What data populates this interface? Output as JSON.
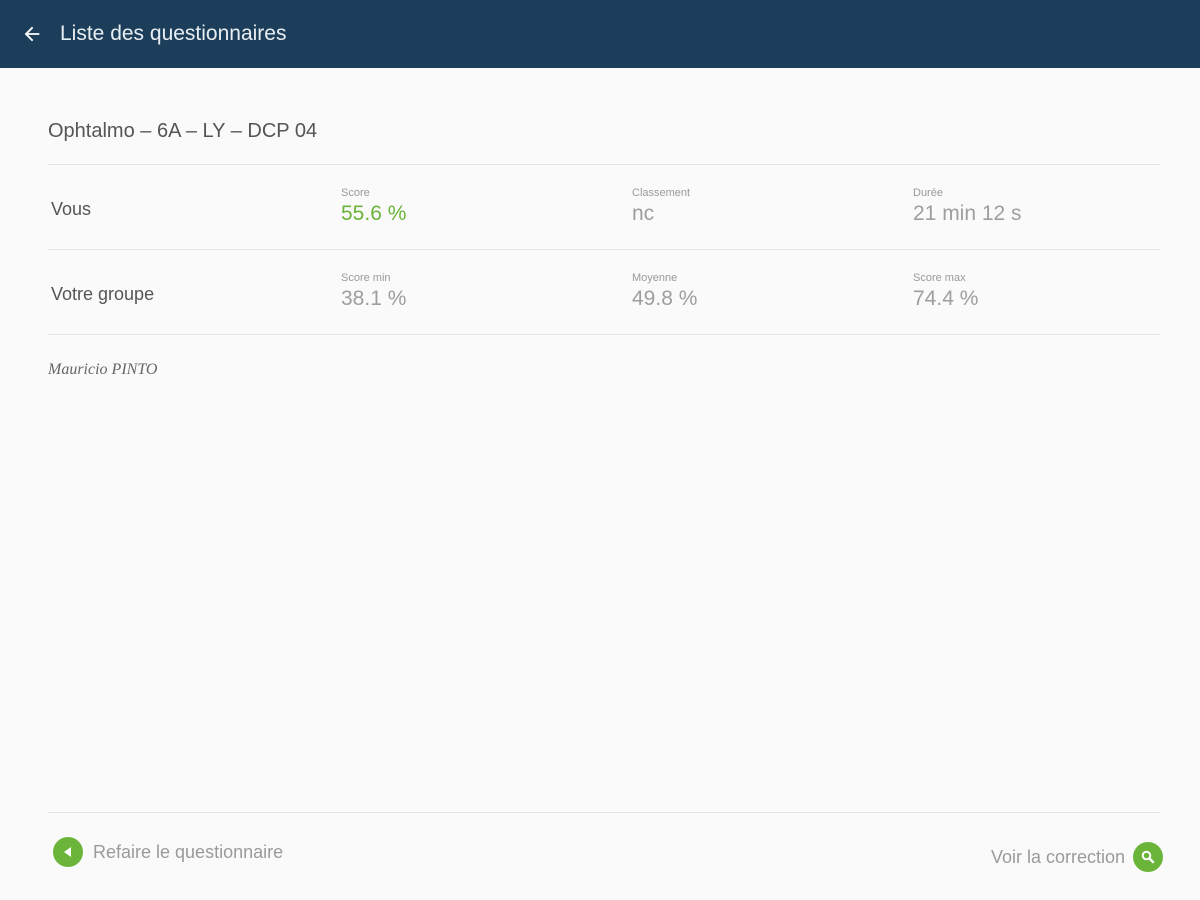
{
  "appbar": {
    "title": "Liste des questionnaires",
    "icon": "arrow-back-icon"
  },
  "quiz": {
    "title": "Ophtalmo – 6A – LY – DCP 04"
  },
  "you": {
    "label": "Vous",
    "stats": [
      {
        "caption": "Score",
        "value": "55.6 %"
      },
      {
        "caption": "Classement",
        "value": "nc"
      },
      {
        "caption": "Durée",
        "value": "21 min 12 s"
      }
    ]
  },
  "group": {
    "label": "Votre groupe",
    "stats": [
      {
        "caption": "Score min",
        "value": "38.1 %"
      },
      {
        "caption": "Moyenne",
        "value": "49.8 %"
      },
      {
        "caption": "Score max",
        "value": "74.4 %"
      }
    ]
  },
  "author": "Mauricio PINTO",
  "actions": {
    "redo_label": "Refaire le questionnaire",
    "redo_icon": "play-back-icon",
    "correction_label": "Voir la correction",
    "correction_icon": "search-icon"
  },
  "colors": {
    "appbar": "#1c3e5a",
    "accent": "#6ab43a"
  }
}
